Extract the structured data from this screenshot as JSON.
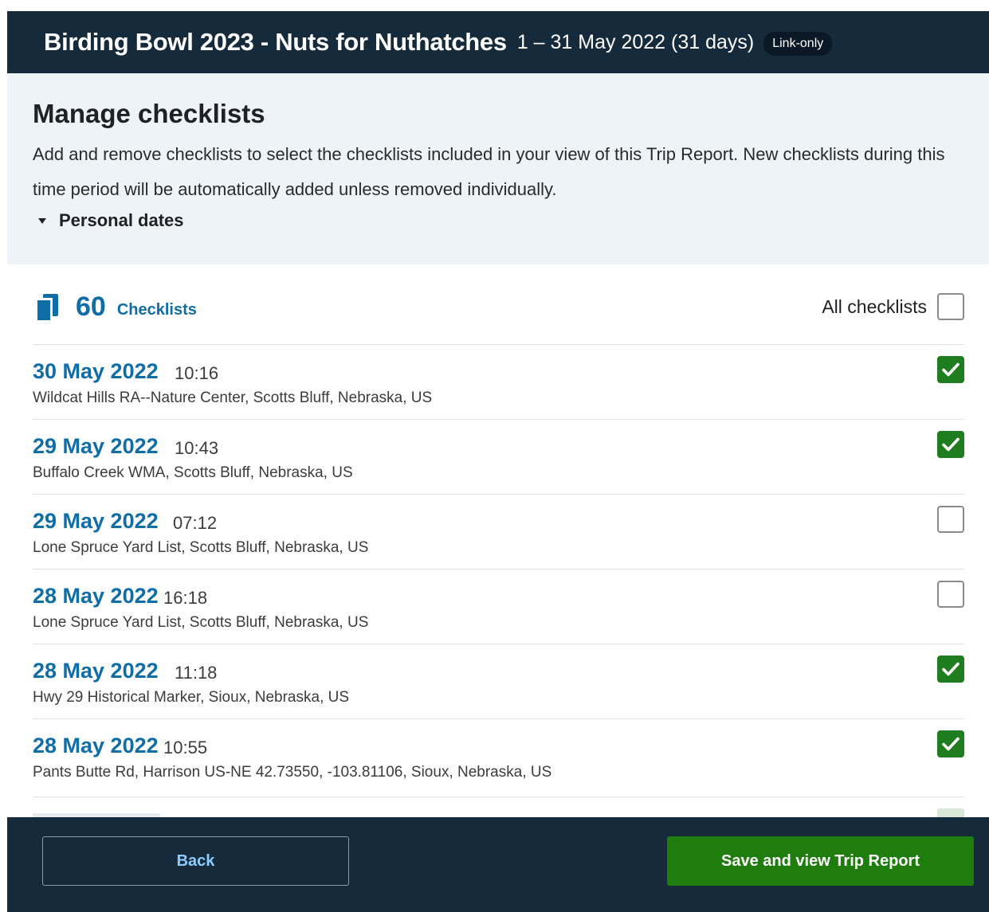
{
  "header": {
    "title": "Birding Bowl 2023 - Nuts for Nuthatches",
    "dates": "1 – 31 May 2022 (31 days)",
    "badge": "Link-only"
  },
  "manage": {
    "heading": "Manage checklists",
    "description": "Add and remove checklists to select the checklists included in your view of this Trip Report. New checklists during this time period will be automatically added unless removed individually.",
    "personal_dates_label": "Personal dates"
  },
  "summary": {
    "count": "60",
    "count_label": "Checklists",
    "all_label": "All checklists",
    "all_checked": false
  },
  "checklists": [
    {
      "date": "30 May 2022",
      "time": "10:16",
      "location": "Wildcat Hills RA--Nature Center, Scotts Bluff, Nebraska, US",
      "checked": true
    },
    {
      "date": "29 May 2022",
      "time": "10:43",
      "location": "Buffalo Creek WMA, Scotts Bluff, Nebraska, US",
      "checked": true
    },
    {
      "date": "29 May 2022",
      "time": "07:12",
      "location": "Lone Spruce Yard List, Scotts Bluff, Nebraska, US",
      "checked": false
    },
    {
      "date": "28 May 2022",
      "time": "16:18",
      "location": "Lone Spruce Yard List, Scotts Bluff, Nebraska, US",
      "checked": false
    },
    {
      "date": "28 May 2022",
      "time": "11:18",
      "location": "Hwy 29 Historical Marker, Sioux, Nebraska, US",
      "checked": true
    },
    {
      "date": "28 May 2022",
      "time": "10:55",
      "location": "Pants Butte Rd, Harrison US-NE 42.73550, -103.81106, Sioux, Nebraska, US",
      "checked": true
    }
  ],
  "footer": {
    "back_label": "Back",
    "save_label": "Save and view Trip Report"
  },
  "colors": {
    "header_bg": "#152b3c",
    "link_blue": "#0f6da8",
    "check_green": "#1e7d1e",
    "save_green": "#1f7d0d"
  }
}
